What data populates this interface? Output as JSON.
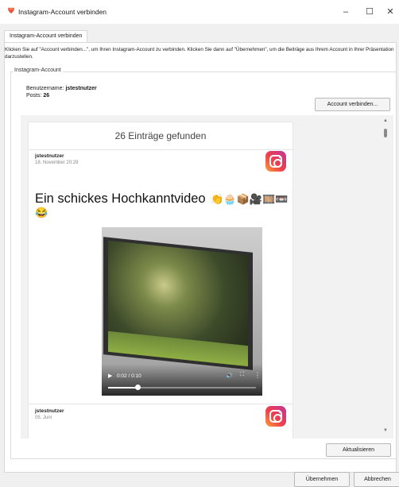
{
  "window": {
    "title": "Instagram-Account verbinden",
    "minimize_glyph": "–",
    "maximize_glyph": "☐",
    "close_glyph": "✕"
  },
  "tab": {
    "label": "Instagram-Account verbinden"
  },
  "instructions": "Klicken Sie auf \"Account verbinden...\", um Ihren Instagram-Account zu verbinden. Klicken Sie dann auf \"Übernehmen\", um die Beiträge aus Ihrem Account in Ihrer Präsentation darzustellen.",
  "account": {
    "group_label": "Instagram-Account",
    "username_label": "Benutzername:",
    "username": "jstestnutzer",
    "posts_label": "Posts:",
    "posts": "26",
    "connect_button": "Account verbinden..."
  },
  "feed": {
    "header": "26 Einträge gefunden",
    "posts": [
      {
        "user": "jstestnutzer",
        "date": "18. November 20:29",
        "caption": "Ein schickes Hochkanntvideo",
        "caption_emojis": "👏🧁📦🎥🎞️📼",
        "caption_emojis_line2": "😂",
        "video": {
          "current_time": "0:02",
          "duration": "0:10",
          "time_label": "0:02 / 0:10",
          "progress_fraction": 0.2
        }
      },
      {
        "user": "jstestnutzer",
        "date": "05. Juni",
        "emojis": "🍒🎀🐬🌸🔺🍅🍄🧱🐾🌿🔶🌺"
      }
    ]
  },
  "buttons": {
    "refresh": "Aktualisieren",
    "apply": "Übernehmen",
    "cancel": "Abbrechen"
  },
  "icons": {
    "app": "instagram-app-icon",
    "post_logo": "instagram-logo-icon",
    "play": "▶",
    "volume": "🔊",
    "fullscreen": "⛶",
    "more": "⋮",
    "scroll_up": "▲",
    "scroll_down": "▼"
  },
  "colors": {
    "instagram_gradient_start": "#f9a13a",
    "instagram_gradient_mid": "#ef3f4b",
    "instagram_gradient_end": "#c1359c"
  }
}
